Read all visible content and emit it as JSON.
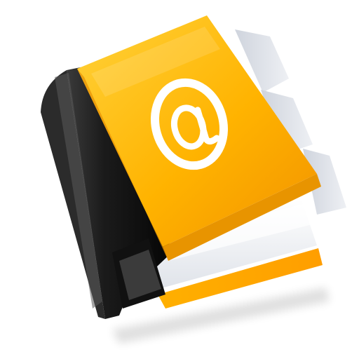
{
  "icon": {
    "name": "address-book-icon",
    "symbol": "@",
    "colors": {
      "cover_light": "#ffcf2e",
      "cover_main": "#ffb400",
      "cover_dark": "#f09000",
      "spine_dark": "#141414",
      "spine_highlight": "#4a4a4a",
      "tabs": "#dfe3ea",
      "pages": "#f4f5f8",
      "symbol": "#ffffff"
    }
  }
}
